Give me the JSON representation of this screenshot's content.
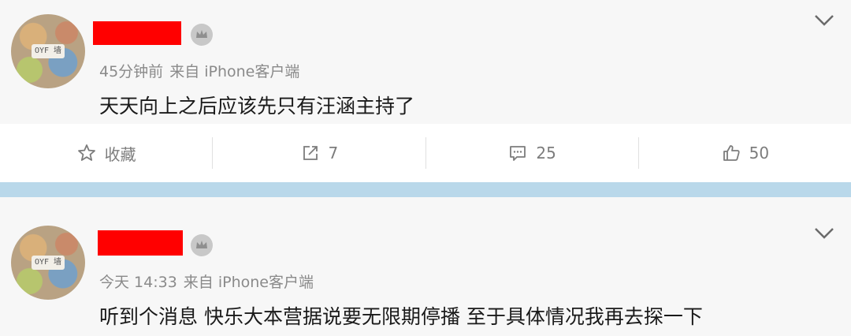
{
  "post1": {
    "avatar_tag": "OYF 墙",
    "meta_time": "45分钟前",
    "meta_source": "来自 iPhone客户端",
    "content": "天天向上之后应该先只有汪涵主持了",
    "actions": {
      "favorite_label": "收藏",
      "repost_count": "7",
      "comment_count": "25",
      "like_count": "50"
    }
  },
  "post2": {
    "avatar_tag": "OYF 墙",
    "meta_time": "今天 14:33",
    "meta_source": "来自 iPhone客户端",
    "content": "听到个消息 快乐大本营据说要无限期停播 至于具体情况我再去探一下"
  },
  "icons": {
    "favorite": "star-outline-icon",
    "repost": "share-arrow-icon",
    "comment": "comment-icon",
    "like": "thumbs-up-icon",
    "menu": "chevron-down-icon",
    "badge": "crown-badge-icon"
  },
  "colors": {
    "redaction": "#ff0000",
    "divider": "#b9d8ea",
    "meta_gray": "#8a8a8a"
  }
}
